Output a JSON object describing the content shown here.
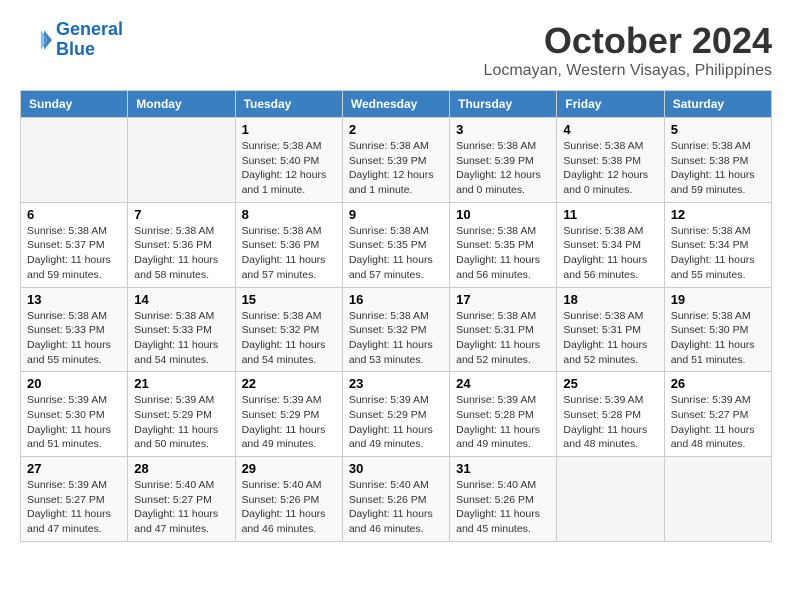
{
  "header": {
    "logo_line1": "General",
    "logo_line2": "Blue",
    "month_title": "October 2024",
    "location": "Locmayan, Western Visayas, Philippines"
  },
  "days_of_week": [
    "Sunday",
    "Monday",
    "Tuesday",
    "Wednesday",
    "Thursday",
    "Friday",
    "Saturday"
  ],
  "weeks": [
    [
      {
        "day": "",
        "info": ""
      },
      {
        "day": "",
        "info": ""
      },
      {
        "day": "1",
        "info": "Sunrise: 5:38 AM\nSunset: 5:40 PM\nDaylight: 12 hours and 1 minute."
      },
      {
        "day": "2",
        "info": "Sunrise: 5:38 AM\nSunset: 5:39 PM\nDaylight: 12 hours and 1 minute."
      },
      {
        "day": "3",
        "info": "Sunrise: 5:38 AM\nSunset: 5:39 PM\nDaylight: 12 hours and 0 minutes."
      },
      {
        "day": "4",
        "info": "Sunrise: 5:38 AM\nSunset: 5:38 PM\nDaylight: 12 hours and 0 minutes."
      },
      {
        "day": "5",
        "info": "Sunrise: 5:38 AM\nSunset: 5:38 PM\nDaylight: 11 hours and 59 minutes."
      }
    ],
    [
      {
        "day": "6",
        "info": "Sunrise: 5:38 AM\nSunset: 5:37 PM\nDaylight: 11 hours and 59 minutes."
      },
      {
        "day": "7",
        "info": "Sunrise: 5:38 AM\nSunset: 5:36 PM\nDaylight: 11 hours and 58 minutes."
      },
      {
        "day": "8",
        "info": "Sunrise: 5:38 AM\nSunset: 5:36 PM\nDaylight: 11 hours and 57 minutes."
      },
      {
        "day": "9",
        "info": "Sunrise: 5:38 AM\nSunset: 5:35 PM\nDaylight: 11 hours and 57 minutes."
      },
      {
        "day": "10",
        "info": "Sunrise: 5:38 AM\nSunset: 5:35 PM\nDaylight: 11 hours and 56 minutes."
      },
      {
        "day": "11",
        "info": "Sunrise: 5:38 AM\nSunset: 5:34 PM\nDaylight: 11 hours and 56 minutes."
      },
      {
        "day": "12",
        "info": "Sunrise: 5:38 AM\nSunset: 5:34 PM\nDaylight: 11 hours and 55 minutes."
      }
    ],
    [
      {
        "day": "13",
        "info": "Sunrise: 5:38 AM\nSunset: 5:33 PM\nDaylight: 11 hours and 55 minutes."
      },
      {
        "day": "14",
        "info": "Sunrise: 5:38 AM\nSunset: 5:33 PM\nDaylight: 11 hours and 54 minutes."
      },
      {
        "day": "15",
        "info": "Sunrise: 5:38 AM\nSunset: 5:32 PM\nDaylight: 11 hours and 54 minutes."
      },
      {
        "day": "16",
        "info": "Sunrise: 5:38 AM\nSunset: 5:32 PM\nDaylight: 11 hours and 53 minutes."
      },
      {
        "day": "17",
        "info": "Sunrise: 5:38 AM\nSunset: 5:31 PM\nDaylight: 11 hours and 52 minutes."
      },
      {
        "day": "18",
        "info": "Sunrise: 5:38 AM\nSunset: 5:31 PM\nDaylight: 11 hours and 52 minutes."
      },
      {
        "day": "19",
        "info": "Sunrise: 5:38 AM\nSunset: 5:30 PM\nDaylight: 11 hours and 51 minutes."
      }
    ],
    [
      {
        "day": "20",
        "info": "Sunrise: 5:39 AM\nSunset: 5:30 PM\nDaylight: 11 hours and 51 minutes."
      },
      {
        "day": "21",
        "info": "Sunrise: 5:39 AM\nSunset: 5:29 PM\nDaylight: 11 hours and 50 minutes."
      },
      {
        "day": "22",
        "info": "Sunrise: 5:39 AM\nSunset: 5:29 PM\nDaylight: 11 hours and 49 minutes."
      },
      {
        "day": "23",
        "info": "Sunrise: 5:39 AM\nSunset: 5:29 PM\nDaylight: 11 hours and 49 minutes."
      },
      {
        "day": "24",
        "info": "Sunrise: 5:39 AM\nSunset: 5:28 PM\nDaylight: 11 hours and 49 minutes."
      },
      {
        "day": "25",
        "info": "Sunrise: 5:39 AM\nSunset: 5:28 PM\nDaylight: 11 hours and 48 minutes."
      },
      {
        "day": "26",
        "info": "Sunrise: 5:39 AM\nSunset: 5:27 PM\nDaylight: 11 hours and 48 minutes."
      }
    ],
    [
      {
        "day": "27",
        "info": "Sunrise: 5:39 AM\nSunset: 5:27 PM\nDaylight: 11 hours and 47 minutes."
      },
      {
        "day": "28",
        "info": "Sunrise: 5:40 AM\nSunset: 5:27 PM\nDaylight: 11 hours and 47 minutes."
      },
      {
        "day": "29",
        "info": "Sunrise: 5:40 AM\nSunset: 5:26 PM\nDaylight: 11 hours and 46 minutes."
      },
      {
        "day": "30",
        "info": "Sunrise: 5:40 AM\nSunset: 5:26 PM\nDaylight: 11 hours and 46 minutes."
      },
      {
        "day": "31",
        "info": "Sunrise: 5:40 AM\nSunset: 5:26 PM\nDaylight: 11 hours and 45 minutes."
      },
      {
        "day": "",
        "info": ""
      },
      {
        "day": "",
        "info": ""
      }
    ]
  ]
}
